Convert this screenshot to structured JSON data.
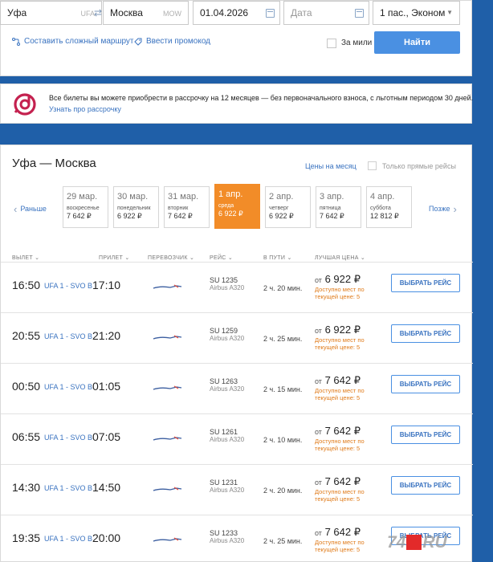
{
  "search": {
    "from_city": "Уфа",
    "from_code": "UFA",
    "to_city": "Москва",
    "to_code": "MOW",
    "depart_date": "01.04.2026",
    "return_placeholder": "Дата",
    "passengers": "1 пас., Эконом",
    "complex_route_link": "Составить сложный маршрут",
    "promo_link": "Ввести промокод",
    "miles_label": "За мили",
    "find_button": "Найти"
  },
  "banner": {
    "text": "Все билеты вы можете приобрести в рассрочку на 12 месяцев — без первоначального взноса, с льготным периодом 30 дней.",
    "link": "Узнать про рассрочку",
    "logo_color": "#c4214f"
  },
  "results": {
    "route_title": "Уфа — Москва",
    "month_prices_link": "Цены на месяц",
    "direct_only_label": "Только прямые рейсы",
    "prev_label": "Раньше",
    "next_label": "Позже",
    "days": [
      {
        "date": "29 мар.",
        "weekday": "воскресенье",
        "price": "7 642 ₽",
        "active": false
      },
      {
        "date": "30 мар.",
        "weekday": "понедельник",
        "price": "6 922 ₽",
        "active": false
      },
      {
        "date": "31 мар.",
        "weekday": "вторник",
        "price": "7 642 ₽",
        "active": false
      },
      {
        "date": "1 апр.",
        "weekday": "среда",
        "price": "6 922 ₽",
        "active": true
      },
      {
        "date": "2 апр.",
        "weekday": "четверг",
        "price": "6 922 ₽",
        "active": false
      },
      {
        "date": "3 апр.",
        "weekday": "пятница",
        "price": "7 642 ₽",
        "active": false
      },
      {
        "date": "4 апр.",
        "weekday": "суббота",
        "price": "12 812 ₽",
        "active": false
      }
    ],
    "columns": {
      "departure": "ВЫЛЕТ",
      "arrival": "ПРИЛЕТ",
      "carrier": "ПЕРЕВОЗЧИК",
      "flight": "РЕЙС",
      "duration": "В ПУТИ",
      "best_price": "ЛУЧШАЯ ЦЕНА"
    },
    "flights": [
      {
        "dep": "16:50",
        "codes": "UFA 1 - SVO B",
        "arr": "17:10",
        "number": "SU 1235",
        "aircraft": "Airbus A320",
        "duration": "2 ч. 20 мин.",
        "price_from": "от",
        "price": "6 922 ₽",
        "avail1": "Доступно мест по",
        "avail2": "текущей цене: 5",
        "button": "ВЫБРАТЬ РЕЙС"
      },
      {
        "dep": "20:55",
        "codes": "UFA 1 - SVO B",
        "arr": "21:20",
        "number": "SU 1259",
        "aircraft": "Airbus A320",
        "duration": "2 ч. 25 мин.",
        "price_from": "от",
        "price": "6 922 ₽",
        "avail1": "Доступно мест по",
        "avail2": "текущей цене: 5",
        "button": "ВЫБРАТЬ РЕЙС"
      },
      {
        "dep": "00:50",
        "codes": "UFA 1 - SVO B",
        "arr": "01:05",
        "number": "SU 1263",
        "aircraft": "Airbus A320",
        "duration": "2 ч. 15 мин.",
        "price_from": "от",
        "price": "7 642 ₽",
        "avail1": "Доступно мест по",
        "avail2": "текущей цене: 5",
        "button": "ВЫБРАТЬ РЕЙС"
      },
      {
        "dep": "06:55",
        "codes": "UFA 1 - SVO B",
        "arr": "07:05",
        "number": "SU 1261",
        "aircraft": "Airbus A320",
        "duration": "2 ч. 10 мин.",
        "price_from": "от",
        "price": "7 642 ₽",
        "avail1": "Доступно мест по",
        "avail2": "текущей цене: 5",
        "button": "ВЫБРАТЬ РЕЙС"
      },
      {
        "dep": "14:30",
        "codes": "UFA 1 - SVO B",
        "arr": "14:50",
        "number": "SU 1231",
        "aircraft": "Airbus A320",
        "duration": "2 ч. 20 мин.",
        "price_from": "от",
        "price": "7 642 ₽",
        "avail1": "Доступно мест по",
        "avail2": "текущей цене: 5",
        "button": "ВЫБРАТЬ РЕЙС"
      },
      {
        "dep": "19:35",
        "codes": "UFA 1 - SVO B",
        "arr": "20:00",
        "number": "SU 1233",
        "aircraft": "Airbus A320",
        "duration": "2 ч. 25 мин.",
        "price_from": "от",
        "price": "7 642 ₽",
        "avail1": "Доступно мест по",
        "avail2": "текущей цене: 5",
        "button": "ВЫБРАТЬ РЕЙС"
      }
    ]
  },
  "watermark": {
    "left": "74",
    "right": "RU",
    "accent": "#e32a2a"
  },
  "colors": {
    "accent_blue": "#4a90e2",
    "active_day": "#f28c28",
    "availability": "#e07b1a",
    "background": "#1f5fa8"
  }
}
